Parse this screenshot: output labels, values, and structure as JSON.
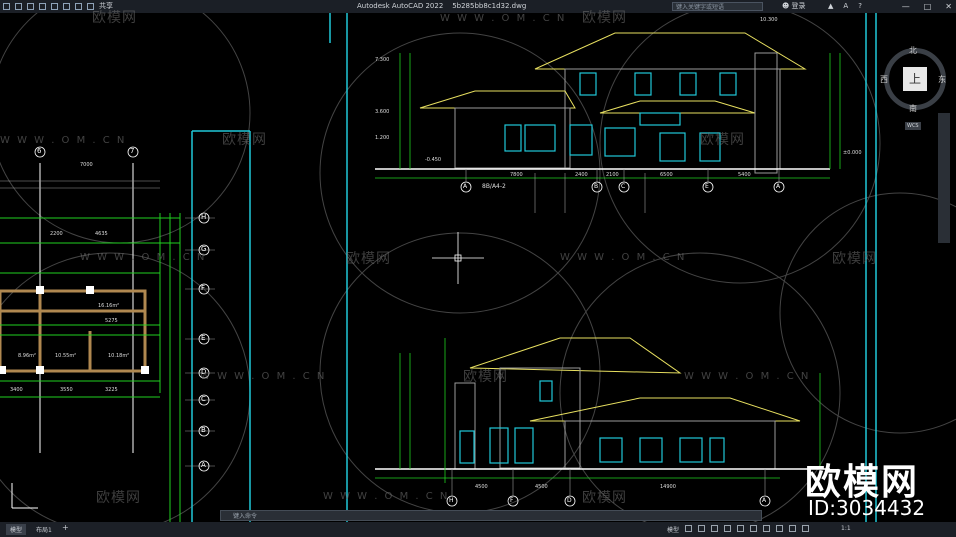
{
  "app": {
    "title": "Autodesk AutoCAD 2022",
    "filename": "5b285bb8c1d32.dwg",
    "share_label": "共享",
    "search_placeholder": "键入关键字或短语",
    "login_label": "登录"
  },
  "compass": {
    "north": "北",
    "south": "南",
    "east": "东",
    "west": "西",
    "top": "上",
    "wcs": "WCS"
  },
  "watermark": {
    "text": "欧模网",
    "url": "W W W . O M . C N",
    "url_plain": "www.om.cn",
    "big_text": "欧模网",
    "id_text": "ID:3034432"
  },
  "drawing": {
    "grid_labels_left": [
      "H",
      "G",
      "F",
      "E",
      "D",
      "C",
      "B",
      "A",
      "A"
    ],
    "grid_labels_top": [
      "6",
      "7"
    ],
    "elev1_axis": [
      "A",
      "B",
      "C",
      "E",
      "A"
    ],
    "elev2_axis": [
      "H",
      "F",
      "D",
      "A"
    ],
    "levels": [
      "10.300",
      "7.300",
      "3.600",
      "1.200",
      "±0.000",
      "-0.450"
    ],
    "dims_top": [
      "7000",
      "2200",
      "4635",
      "5275"
    ],
    "dims_bottom": [
      "3400",
      "3550",
      "3225"
    ],
    "rooms": [
      "16.16m²",
      "8.96m²",
      "10.55m²",
      "10.18m²"
    ],
    "elev1_dims": [
      "7800",
      "2400",
      "2100",
      "6500",
      "5400"
    ],
    "elev2_dims": [
      "4500",
      "4500",
      "14900"
    ],
    "elev1_label": "8B/A4-2"
  },
  "cmdline": {
    "placeholder": "键入命令"
  },
  "status": {
    "model_tab": "模型",
    "layout_tab": "布局1",
    "plus": "+",
    "model_label": "模型",
    "scale": "1:1"
  },
  "colors": {
    "background": "#000000",
    "accent_cyan": "#20c8d8",
    "line_yellow": "#e8e060",
    "line_green": "#20d020",
    "line_gray": "#9a9a9a"
  }
}
